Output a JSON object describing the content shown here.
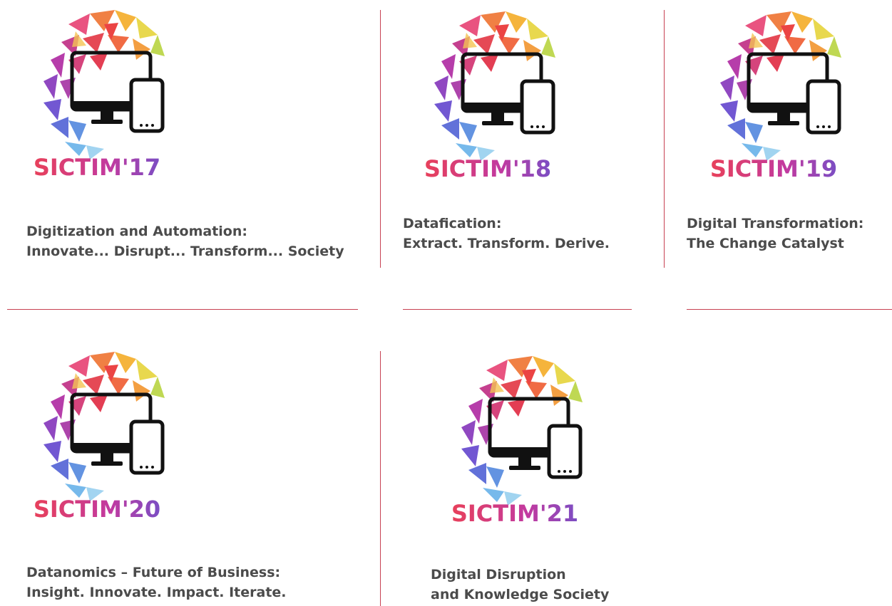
{
  "colors": {
    "divider": "#c74152",
    "title_text": "#4b4b4b",
    "logo_gradient": [
      "#e8405a",
      "#c23aa0",
      "#7a4ec4"
    ]
  },
  "icons": [
    "globe-mosaic-icon",
    "desktop-monitor-icon",
    "tablet-icon"
  ],
  "events": [
    {
      "logo_text": "SICTIM'17",
      "title_line1": "Digitization and Automation:",
      "title_line2": "Innovate... Disrupt... Transform... Society"
    },
    {
      "logo_text": "SICTIM'18",
      "title_line1": "Datafication:",
      "title_line2": "Extract. Transform. Derive."
    },
    {
      "logo_text": "SICTIM'19",
      "title_line1": "Digital Transformation:",
      "title_line2": "The Change Catalyst"
    },
    {
      "logo_text": "SICTIM'20",
      "title_line1": "Datanomics – Future of Business:",
      "title_line2": "Insight. Innovate. Impact. Iterate."
    },
    {
      "logo_text": "SICTIM'21",
      "title_line1": "Digital Disruption",
      "title_line2": "and Knowledge Society"
    }
  ]
}
